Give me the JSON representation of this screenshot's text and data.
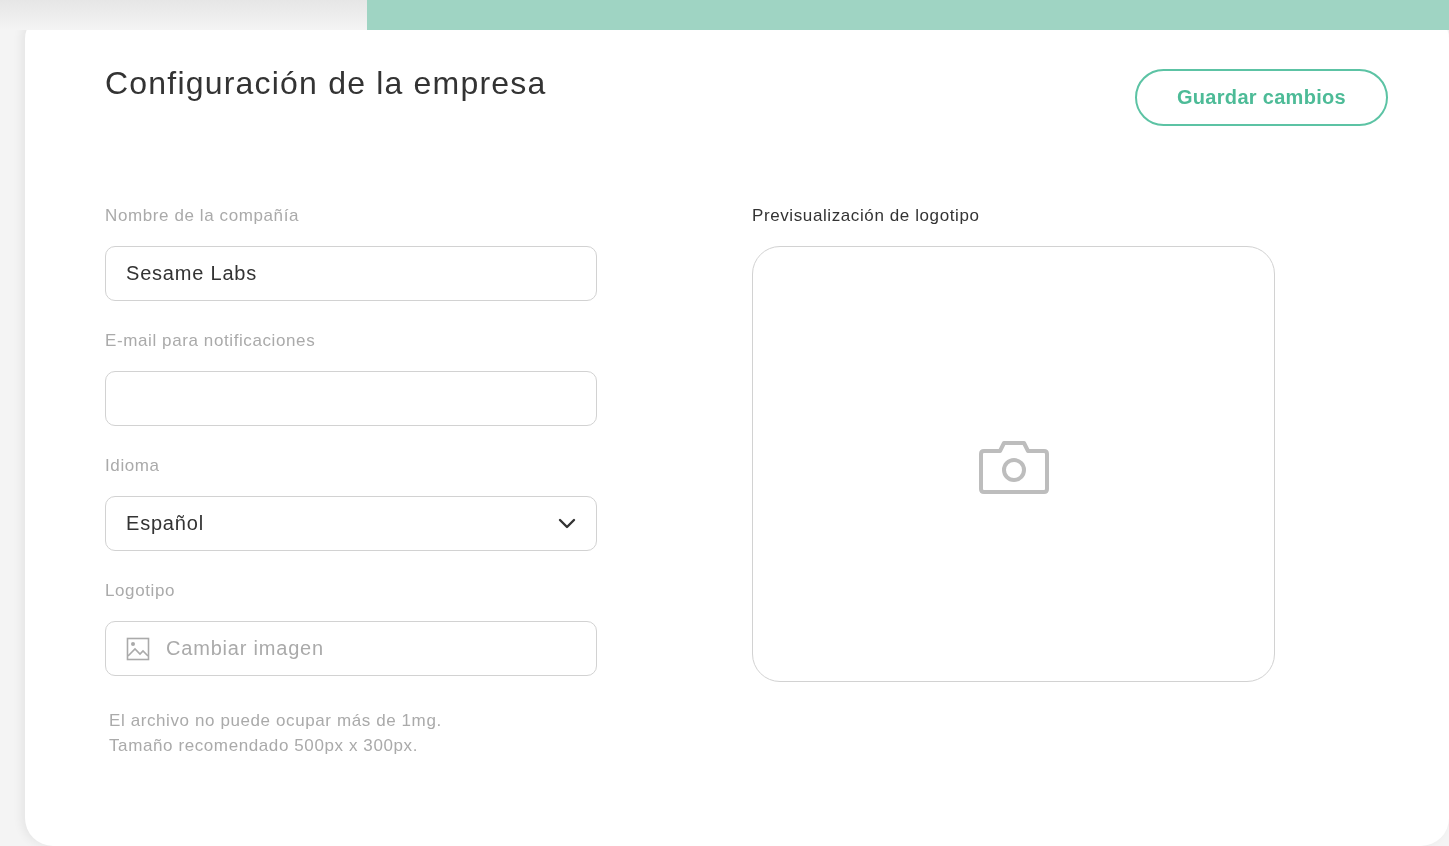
{
  "header": {
    "title": "Configuración de la empresa",
    "save_button": "Guardar cambios"
  },
  "fields": [
    {
      "kind": "text",
      "label": "Nombre de la compañía",
      "value": "Sesame Labs"
    },
    {
      "kind": "text",
      "label": "E-mail para notificaciones"
    },
    {
      "kind": "select",
      "label": "Idioma",
      "value": "Español"
    },
    {
      "kind": "file",
      "label": "Logotipo",
      "placeholder": "Cambiar imagen"
    }
  ],
  "hint_lines": [
    "El archivo no puede ocupar más de 1mg.",
    "Tamaño recomendado 500px x 300px."
  ],
  "preview": {
    "label": "Previsualización de logotipo"
  }
}
